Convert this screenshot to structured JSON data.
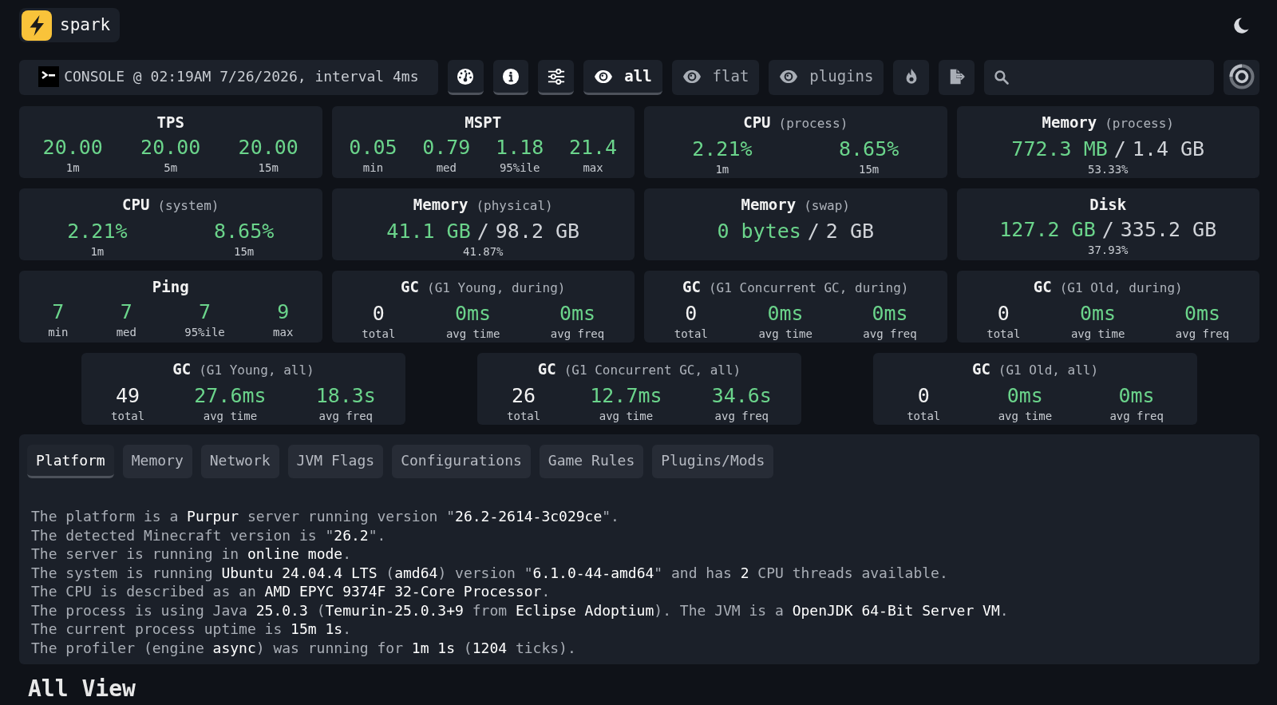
{
  "header": {
    "brand": "spark"
  },
  "toolbar": {
    "metadata": "CONSOLE @ 02:19AM 7/26/2026, interval 4ms",
    "toggles": [
      {
        "active": true
      },
      {
        "active": true
      },
      {
        "active": true
      }
    ],
    "view_modes": [
      {
        "label": "all",
        "selected": true
      },
      {
        "label": "flat",
        "selected": false
      },
      {
        "label": "plugins",
        "selected": false
      }
    ],
    "actions": [
      {
        "active": false
      },
      {
        "active": false
      }
    ]
  },
  "stat_rows": [
    {
      "cards": [
        {
          "kind": "metrics",
          "title": "TPS",
          "metrics": [
            {
              "value": "20.00",
              "label": "1m",
              "color": "#6bd48b"
            },
            {
              "value": "20.00",
              "label": "5m",
              "color": "#6bd48b"
            },
            {
              "value": "20.00",
              "label": "15m",
              "color": "#6bd48b"
            }
          ]
        },
        {
          "kind": "metrics",
          "title": "MSPT",
          "metrics": [
            {
              "value": "0.05",
              "label": "min",
              "color": "#6bd48b"
            },
            {
              "value": "0.79",
              "label": "med",
              "color": "#6bd48b"
            },
            {
              "value": "1.18",
              "label": "95%ile",
              "color": "#6bd48b"
            },
            {
              "value": "21.4",
              "label": "max",
              "color": "#6bd48b"
            }
          ]
        },
        {
          "kind": "metrics",
          "title": "CPU",
          "qualifier": "(process)",
          "metrics": [
            {
              "value": "2.21%",
              "label": "1m",
              "color": "#6bd48b"
            },
            {
              "value": "8.65%",
              "label": "15m",
              "color": "#6bd48b"
            }
          ]
        },
        {
          "kind": "usage",
          "title": "Memory",
          "qualifier": "(process)",
          "used": "772.3 MB",
          "separator": "/",
          "total": "1.4 GB",
          "percent": "53.33%"
        }
      ]
    },
    {
      "cards": [
        {
          "kind": "metrics",
          "title": "CPU",
          "qualifier": "(system)",
          "metrics": [
            {
              "value": "2.21%",
              "label": "1m",
              "color": "#6bd48b"
            },
            {
              "value": "8.65%",
              "label": "15m",
              "color": "#6bd48b"
            }
          ]
        },
        {
          "kind": "usage",
          "title": "Memory",
          "qualifier": "(physical)",
          "used": "41.1 GB",
          "separator": "/",
          "total": "98.2 GB",
          "percent": "41.87%"
        },
        {
          "kind": "usage",
          "title": "Memory",
          "qualifier": "(swap)",
          "used": "0 bytes",
          "separator": "/",
          "total": "2 GB"
        },
        {
          "kind": "usage",
          "title": "Disk",
          "used": "127.2 GB",
          "separator": "/",
          "total": "335.2 GB",
          "percent": "37.93%"
        }
      ]
    },
    {
      "cards": [
        {
          "kind": "metrics",
          "title": "Ping",
          "metrics": [
            {
              "value": "7",
              "label": "min",
              "color": "#6bd48b"
            },
            {
              "value": "7",
              "label": "med",
              "color": "#6bd48b"
            },
            {
              "value": "7",
              "label": "95%ile",
              "color": "#6bd48b"
            },
            {
              "value": "9",
              "label": "max",
              "color": "#6bd48b"
            }
          ]
        },
        {
          "kind": "metrics",
          "title": "GC",
          "qualifier": "(G1 Young, during)",
          "metrics": [
            {
              "value": "0",
              "label": "total",
              "color": "#f2f2f2"
            },
            {
              "value": "0ms",
              "label": "avg time",
              "color": "#6bd48b"
            },
            {
              "value": "0ms",
              "label": "avg freq",
              "color": "#6bd48b"
            }
          ]
        },
        {
          "kind": "metrics",
          "title": "GC",
          "qualifier": "(G1 Concurrent GC, during)",
          "metrics": [
            {
              "value": "0",
              "label": "total",
              "color": "#f2f2f2"
            },
            {
              "value": "0ms",
              "label": "avg time",
              "color": "#6bd48b"
            },
            {
              "value": "0ms",
              "label": "avg freq",
              "color": "#6bd48b"
            }
          ]
        },
        {
          "kind": "metrics",
          "title": "GC",
          "qualifier": "(G1 Old, during)",
          "metrics": [
            {
              "value": "0",
              "label": "total",
              "color": "#f2f2f2"
            },
            {
              "value": "0ms",
              "label": "avg time",
              "color": "#6bd48b"
            },
            {
              "value": "0ms",
              "label": "avg freq",
              "color": "#6bd48b"
            }
          ]
        }
      ]
    },
    {
      "cards": [
        {
          "kind": "metrics",
          "title": "GC",
          "qualifier": "(G1 Young, all)",
          "metrics": [
            {
              "value": "49",
              "label": "total",
              "color": "#f2f2f2"
            },
            {
              "value": "27.6ms",
              "label": "avg time",
              "color": "#6bd48b"
            },
            {
              "value": "18.3s",
              "label": "avg freq",
              "color": "#6bd48b"
            }
          ]
        },
        {
          "kind": "metrics",
          "title": "GC",
          "qualifier": "(G1 Concurrent GC, all)",
          "metrics": [
            {
              "value": "26",
              "label": "total",
              "color": "#f2f2f2"
            },
            {
              "value": "12.7ms",
              "label": "avg time",
              "color": "#6bd48b"
            },
            {
              "value": "34.6s",
              "label": "avg freq",
              "color": "#6bd48b"
            }
          ]
        },
        {
          "kind": "metrics",
          "title": "GC",
          "qualifier": "(G1 Old, all)",
          "metrics": [
            {
              "value": "0",
              "label": "total",
              "color": "#f2f2f2"
            },
            {
              "value": "0ms",
              "label": "avg time",
              "color": "#6bd48b"
            },
            {
              "value": "0ms",
              "label": "avg freq",
              "color": "#6bd48b"
            }
          ]
        }
      ]
    }
  ],
  "info_panel": {
    "tabs": [
      {
        "label": "Platform",
        "selected": true
      },
      {
        "label": "Memory",
        "selected": false
      },
      {
        "label": "Network",
        "selected": false
      },
      {
        "label": "JVM Flags",
        "selected": false
      },
      {
        "label": "Configurations",
        "selected": false
      },
      {
        "label": "Game Rules",
        "selected": false
      },
      {
        "label": "Plugins/Mods",
        "selected": false
      }
    ],
    "lines": [
      "The platform is a **Purpur** server running version \"**26.2-2614-3c029ce**\".",
      "The detected Minecraft version is \"**26.2**\".",
      "The server is running in **online mode**.",
      "The system is running **Ubuntu 24.04.4 LTS** (**amd64**) version \"**6.1.0-44-amd64**\" and has **2** CPU threads available.",
      "The CPU is described as an **AMD EPYC 9374F 32-Core Processor**.",
      "The process is using Java **25.0.3** (**Temurin-25.0.3+9** from **Eclipse Adoptium**). The JVM is a **OpenJDK 64-Bit Server VM**.",
      "The current process uptime is **15m 1s**.",
      "The profiler (engine **async**) was running for **1m 1s** (**1204** ticks)."
    ]
  },
  "heading": "All View"
}
